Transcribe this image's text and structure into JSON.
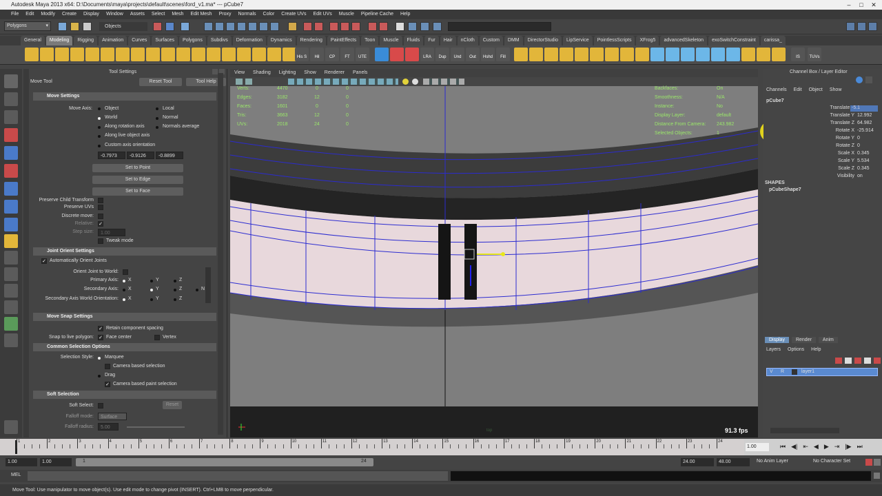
{
  "window": {
    "title": "Autodesk Maya 2013 x64: D:\\Documents\\maya\\projects\\default\\scenes\\ford_v1.ma*  ---  pCube7"
  },
  "menubar": {
    "items": [
      "File",
      "Edit",
      "Modify",
      "Create",
      "Display",
      "Window",
      "Assets",
      "Select",
      "Mesh",
      "Edit Mesh",
      "Proxy",
      "Normals",
      "Color",
      "Create UVs",
      "Edit UVs",
      "Muscle",
      "Pipeline Cache",
      "Help"
    ]
  },
  "statusline": {
    "mode": "Polygons",
    "objects_label": "Objects"
  },
  "shelf": {
    "tabs": [
      "General",
      "Modeling",
      "Rigging",
      "Animation",
      "Curves",
      "Surfaces",
      "Polygons",
      "Subdivs",
      "Deformation",
      "Dynamics",
      "Rendering",
      "PaintEffects",
      "Toon",
      "Muscle",
      "Fluids",
      "Fur",
      "Hair",
      "nCloth",
      "Custom",
      "DMM",
      "DirectorStudio",
      "LipService",
      "PointlessScripts",
      "XFrog5",
      "advancedSkeleton",
      "exoSwitchConstraint",
      "carissa_"
    ],
    "active": "Modeling",
    "labels": [
      "His S",
      "Hil",
      "CP",
      "FT",
      "UTE",
      "LRA",
      "Dup",
      "Und",
      "Out",
      "Hshd",
      "Fill",
      "TUVs",
      "IS"
    ]
  },
  "tool_settings": {
    "panel_title": "Tool Settings",
    "tool_name": "Move Tool",
    "reset_label": "Reset Tool",
    "help_label": "Tool Help",
    "move_settings": {
      "header": "Move Settings",
      "axis_label": "Move Axis:",
      "options": [
        "Object",
        "Local",
        "World",
        "Normal",
        "Along rotation axis",
        "Normals average",
        "Along live object axis",
        "Custom axis orientation"
      ],
      "values": [
        "-0.7973",
        "-0.9126",
        "-0.8899"
      ],
      "btn_point": "Set to Point",
      "btn_edge": "Set to Edge",
      "btn_face": "Set to Face",
      "preserve_child": "Preserve Child Transform",
      "preserve_uvs": "Preserve UVs",
      "discrete": "Discrete move:",
      "relative": "Relative:",
      "step": "Step size:",
      "step_val": "1.00",
      "tweak": "Tweak mode"
    },
    "joint": {
      "header": "Joint Orient Settings",
      "auto": "Automatically Orient Joints",
      "world": "Orient Joint to World:",
      "primary": "Primary Axis:",
      "secondary": "Secondary Axis:",
      "secondary_world": "Secondary Axis World Orientation:",
      "x": "X",
      "y": "Y",
      "z": "Z",
      "none": "N"
    },
    "snap": {
      "header": "Move Snap Settings",
      "retain": "Retain component spacing",
      "snap_live": "Snap to live polygon:",
      "face_center": "Face center",
      "vertex": "Vertex"
    },
    "common": {
      "header": "Common Selection Options",
      "style": "Selection Style:",
      "marquee": "Marquee",
      "camera_based": "Camera based selection",
      "drag": "Drag",
      "camera_paint": "Camera based paint selection"
    },
    "soft": {
      "header": "Soft Selection",
      "soft_select": "Soft Select:",
      "reset": "Reset",
      "falloff_mode": "Falloff mode:",
      "falloff_mode_val": "Surface",
      "falloff_radius": "Falloff radius:",
      "falloff_radius_val": "5.00"
    }
  },
  "viewport": {
    "menu": [
      "View",
      "Shading",
      "Lighting",
      "Show",
      "Renderer",
      "Panels"
    ],
    "hud_left": [
      {
        "label": "Verts:",
        "a": "4470",
        "b": "0",
        "c": "0"
      },
      {
        "label": "Edges:",
        "a": "3182",
        "b": "12",
        "c": "0"
      },
      {
        "label": "Faces:",
        "a": "1601",
        "b": "0",
        "c": "0"
      },
      {
        "label": "Tris:",
        "a": "3663",
        "b": "12",
        "c": "0"
      },
      {
        "label": "UVs:",
        "a": "2018",
        "b": "24",
        "c": "0"
      }
    ],
    "hud_right": [
      {
        "label": "Backfaces:",
        "value": "On"
      },
      {
        "label": "Smoothness:",
        "value": "N/A"
      },
      {
        "label": "Instance:",
        "value": "No"
      },
      {
        "label": "Display Layer:",
        "value": "default"
      },
      {
        "label": "Distance From Camera:",
        "value": "243.982"
      },
      {
        "label": "Selected Objects:",
        "value": "1"
      }
    ],
    "fps": "91.3 fps",
    "cam": "top"
  },
  "channel_box": {
    "panel_title": "Channel Box / Layer Editor",
    "menu": [
      "Channels",
      "Edit",
      "Object",
      "Show"
    ],
    "object": "pCube7",
    "attrs": [
      {
        "name": "Translate X",
        "value": "-5.1"
      },
      {
        "name": "Translate Y",
        "value": "12.992"
      },
      {
        "name": "Translate Z",
        "value": "64.982"
      },
      {
        "name": "Rotate X",
        "value": "-25.914"
      },
      {
        "name": "Rotate Y",
        "value": "0"
      },
      {
        "name": "Rotate Z",
        "value": "0"
      },
      {
        "name": "Scale X",
        "value": "0.345"
      },
      {
        "name": "Scale Y",
        "value": "5.534"
      },
      {
        "name": "Scale Z",
        "value": "0.345"
      },
      {
        "name": "Visibility",
        "value": "on"
      }
    ],
    "shapes_label": "SHAPES",
    "shape": "pCubeShape7"
  },
  "layer_editor": {
    "tabs": [
      "Display",
      "Render",
      "Anim"
    ],
    "menu": [
      "Layers",
      "Options",
      "Help"
    ],
    "layer": {
      "v": "V",
      "r": "R",
      "name": "layer1"
    }
  },
  "timeline": {
    "ticks": [
      "1",
      "2",
      "3",
      "4",
      "5",
      "6",
      "7",
      "8",
      "9",
      "10",
      "11",
      "12",
      "13",
      "14",
      "15",
      "16",
      "17",
      "18",
      "19",
      "20",
      "21",
      "22",
      "23",
      "24"
    ],
    "current": "1.00"
  },
  "range": {
    "start": "1.00",
    "start2": "1.00",
    "slider_start": "1",
    "slider_end": "24",
    "end1": "24.00",
    "end2": "48.00",
    "anim_layer": "No Anim Layer",
    "char_set": "No Character Set"
  },
  "cmdline": {
    "label": "MEL"
  },
  "helpline": {
    "text": "Move Tool: Use manipulator to move object(s). Use edit mode to change pivot (INSERT). Ctrl+LMB to move perpendicular."
  }
}
